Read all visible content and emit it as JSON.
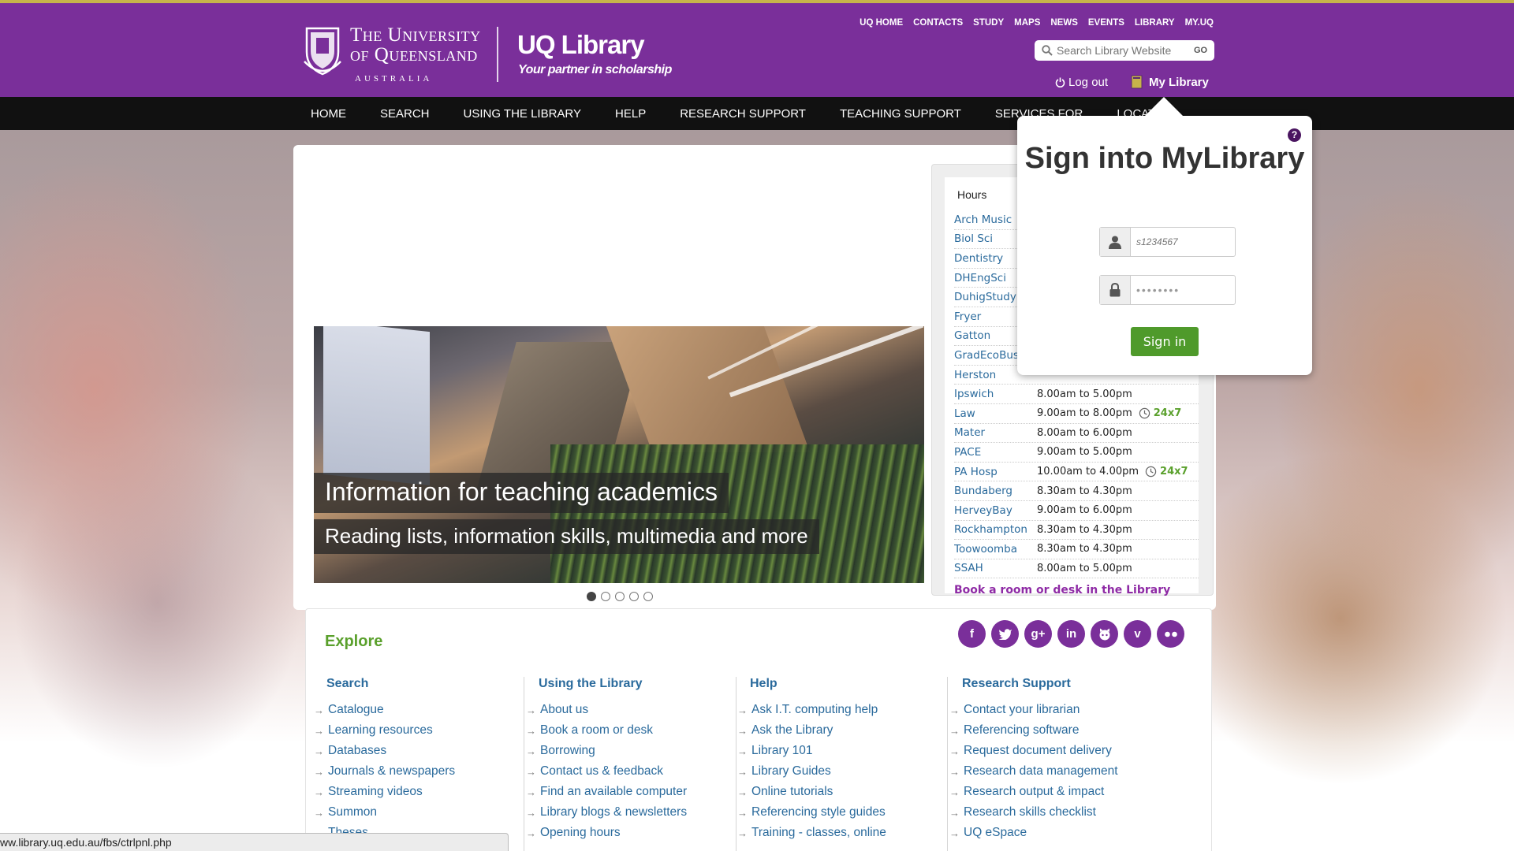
{
  "header": {
    "university": [
      "The University",
      "of Queensland",
      "AUSTRALIA"
    ],
    "title": "UQ Library",
    "tagline": "Your partner in scholarship",
    "top_links": [
      "UQ HOME",
      "CONTACTS",
      "STUDY",
      "MAPS",
      "NEWS",
      "EVENTS",
      "LIBRARY",
      "MY.UQ"
    ],
    "search_placeholder": "Search Library Website",
    "search_go": "GO",
    "logout": "Log out",
    "my_library": "My Library",
    "brand_color": "#7a2f9a"
  },
  "nav": [
    "HOME",
    "SEARCH",
    "USING THE LIBRARY",
    "HELP",
    "RESEARCH SUPPORT",
    "TEACHING SUPPORT",
    "SERVICES FOR",
    "LOCAT"
  ],
  "slider": {
    "caption_title": "Information for teaching academics",
    "caption_sub": "Reading lists, information skills, multimedia and more",
    "slide_count": 5,
    "active_slide": 1
  },
  "hours": {
    "tab": "Hours",
    "rows": [
      {
        "name": "Arch Music",
        "time": "",
        "is247": false
      },
      {
        "name": "Biol Sci",
        "time": "",
        "is247": false
      },
      {
        "name": "Dentistry",
        "time": "",
        "is247": false
      },
      {
        "name": "DHEngSci",
        "time": "",
        "is247": false
      },
      {
        "name": "DuhigStudy",
        "time": "",
        "is247": false
      },
      {
        "name": "Fryer",
        "time": "",
        "is247": false
      },
      {
        "name": "Gatton",
        "time": "",
        "is247": false
      },
      {
        "name": "GradEcoBus",
        "time": "",
        "is247": false
      },
      {
        "name": "Herston",
        "time": "",
        "is247": false
      },
      {
        "name": "Ipswich",
        "time": "8.00am to 5.00pm",
        "is247": false
      },
      {
        "name": "Law",
        "time": "9.00am to 8.00pm",
        "is247": true
      },
      {
        "name": "Mater",
        "time": "8.00am to 6.00pm",
        "is247": false
      },
      {
        "name": "PACE",
        "time": "9.00am to 5.00pm",
        "is247": false
      },
      {
        "name": "PA Hosp",
        "time": "10.00am to 4.00pm",
        "is247": true
      },
      {
        "name": "Bundaberg",
        "time": "8.30am to 4.30pm",
        "is247": false
      },
      {
        "name": "HerveyBay",
        "time": "9.00am to 6.00pm",
        "is247": false
      },
      {
        "name": "Rockhampton",
        "time": "8.30am to 4.30pm",
        "is247": false
      },
      {
        "name": "Toowoomba",
        "time": "8.30am to 4.30pm",
        "is247": false
      },
      {
        "name": "SSAH",
        "time": "8.00am to 5.00pm",
        "is247": false
      }
    ],
    "label_247": "24x7",
    "book_link": "Book a room or desk in the Library"
  },
  "explore": {
    "title": "Explore",
    "social": [
      "f",
      "t",
      "g+",
      "in",
      "github",
      "v",
      "flickr"
    ],
    "columns": [
      {
        "heading": "Search",
        "items": [
          "Catalogue",
          "Learning resources",
          "Databases",
          "Journals & newspapers",
          "Streaming videos",
          "Summon",
          "Theses"
        ]
      },
      {
        "heading": "Using the Library",
        "items": [
          "About us",
          "Book a room or desk",
          "Borrowing",
          "Contact us & feedback",
          "Find an available computer",
          "Library blogs & newsletters",
          "Opening hours"
        ]
      },
      {
        "heading": "Help",
        "items": [
          "Ask I.T. computing help",
          "Ask the Library",
          "Library 101",
          "Library Guides",
          "Online tutorials",
          "Referencing style guides",
          "Training - classes, online"
        ]
      },
      {
        "heading": "Research Support",
        "items": [
          "Contact your librarian",
          "Referencing software",
          "Request document delivery",
          "Research data management",
          "Research output & impact",
          "Research skills checklist",
          "UQ eSpace"
        ]
      }
    ]
  },
  "signin": {
    "title": "Sign into MyLibrary",
    "username_placeholder": "s1234567",
    "password_value": "••••••••",
    "button": "Sign in",
    "help": "?"
  },
  "statusbar": "ww.library.uq.edu.au/fbs/ctrlpnl.php"
}
